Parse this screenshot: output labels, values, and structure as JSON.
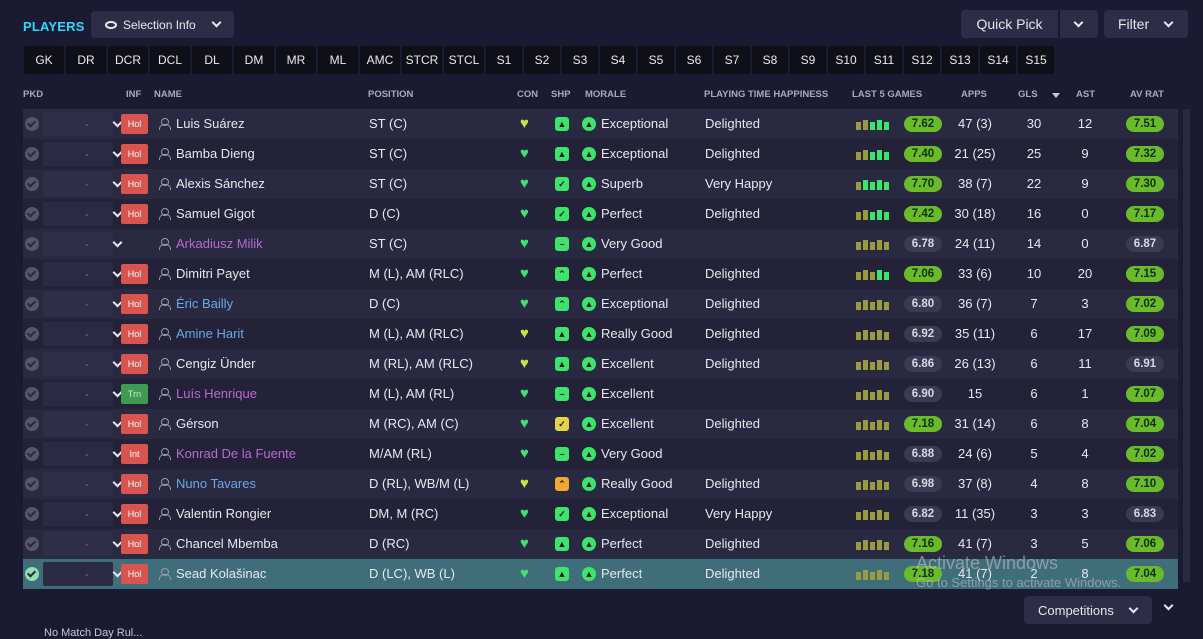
{
  "header": {
    "title": "PLAYERS",
    "selection_info": "Selection Info",
    "quick_pick": "Quick Pick",
    "filter": "Filter"
  },
  "tabs": [
    "GK",
    "DR",
    "DCR",
    "DCL",
    "DL",
    "DM",
    "MR",
    "ML",
    "AMC",
    "STCR",
    "STCL",
    "S1",
    "S2",
    "S3",
    "S4",
    "S5",
    "S6",
    "S7",
    "S8",
    "S9",
    "S10",
    "S11",
    "S12",
    "S13",
    "S14",
    "S15"
  ],
  "columns": {
    "pkd": "PKD",
    "inf": "INF",
    "name": "NAME",
    "position": "POSITION",
    "con": "CON",
    "shp": "SHP",
    "morale": "MORALE",
    "happiness": "PLAYING TIME HAPPINESS",
    "last5": "LAST 5 GAMES",
    "apps": "APPS",
    "gls": "GLS",
    "ast": "AST",
    "avrat": "AV RAT"
  },
  "players": [
    {
      "inf": "Hol",
      "name": "Luis Suárez",
      "name_color": "white",
      "position": "ST (C)",
      "con": "partial",
      "shp": "green",
      "shp_icon": "thumb",
      "morale": "Exceptional",
      "happiness": "Delighted",
      "last5": "7.62",
      "last5_good": true,
      "bars": [
        "y",
        "y",
        "g",
        "g",
        "g"
      ],
      "apps": "47 (3)",
      "gls": "30",
      "ast": "12",
      "avrat": "7.51",
      "avrat_good": true
    },
    {
      "inf": "Hol",
      "name": "Bamba Dieng",
      "name_color": "white",
      "position": "ST (C)",
      "con": "full",
      "shp": "green",
      "shp_icon": "thumb",
      "morale": "Exceptional",
      "happiness": "Delighted",
      "last5": "7.40",
      "last5_good": true,
      "bars": [
        "y",
        "y",
        "g",
        "g",
        "g"
      ],
      "apps": "21 (25)",
      "gls": "25",
      "ast": "9",
      "avrat": "7.32",
      "avrat_good": true
    },
    {
      "inf": "Hol",
      "name": "Alexis Sánchez",
      "name_color": "white",
      "position": "ST (C)",
      "con": "full",
      "shp": "green",
      "shp_icon": "check",
      "morale": "Superb",
      "happiness": "Very Happy",
      "last5": "7.70",
      "last5_good": true,
      "bars": [
        "y",
        "g",
        "g",
        "g",
        "g"
      ],
      "apps": "38 (7)",
      "gls": "22",
      "ast": "9",
      "avrat": "7.30",
      "avrat_good": true
    },
    {
      "inf": "Hol",
      "name": "Samuel Gigot",
      "name_color": "white",
      "position": "D (C)",
      "con": "full",
      "shp": "green",
      "shp_icon": "check",
      "morale": "Perfect",
      "happiness": "Delighted",
      "last5": "7.42",
      "last5_good": true,
      "bars": [
        "y",
        "y",
        "g",
        "g",
        "g"
      ],
      "apps": "30 (18)",
      "gls": "16",
      "ast": "0",
      "avrat": "7.17",
      "avrat_good": true
    },
    {
      "inf": "",
      "name": "Arkadiusz Milik",
      "name_color": "purple",
      "position": "ST (C)",
      "con": "full",
      "shp": "green",
      "shp_icon": "dash",
      "morale": "Very Good",
      "happiness": "",
      "last5": "6.78",
      "last5_good": false,
      "bars": [
        "y",
        "y",
        "y",
        "y",
        "y"
      ],
      "apps": "24 (11)",
      "gls": "14",
      "ast": "0",
      "avrat": "6.87",
      "avrat_good": false
    },
    {
      "inf": "Hol",
      "name": "Dimitri Payet",
      "name_color": "white",
      "position": "M (L), AM (RLC)",
      "con": "full",
      "shp": "green",
      "shp_icon": "up",
      "morale": "Perfect",
      "happiness": "Delighted",
      "last5": "7.06",
      "last5_good": true,
      "bars": [
        "y",
        "y",
        "y",
        "g",
        "g"
      ],
      "apps": "33 (6)",
      "gls": "10",
      "ast": "20",
      "avrat": "7.15",
      "avrat_good": true
    },
    {
      "inf": "Hol",
      "name": "Éric Bailly",
      "name_color": "blue",
      "position": "D (C)",
      "con": "full",
      "shp": "green",
      "shp_icon": "up",
      "morale": "Exceptional",
      "happiness": "Delighted",
      "last5": "6.80",
      "last5_good": false,
      "bars": [
        "y",
        "y",
        "y",
        "y",
        "y"
      ],
      "apps": "36 (7)",
      "gls": "7",
      "ast": "3",
      "avrat": "7.02",
      "avrat_good": true
    },
    {
      "inf": "Hol",
      "name": "Amine Harit",
      "name_color": "blue",
      "position": "M (L), AM (RLC)",
      "con": "partial",
      "shp": "green",
      "shp_icon": "thumb",
      "morale": "Really Good",
      "happiness": "Delighted",
      "last5": "6.92",
      "last5_good": false,
      "bars": [
        "y",
        "y",
        "y",
        "y",
        "y"
      ],
      "apps": "35 (11)",
      "gls": "6",
      "ast": "17",
      "avrat": "7.09",
      "avrat_good": true
    },
    {
      "inf": "Hol",
      "name": "Cengiz Ünder",
      "name_color": "white",
      "position": "M (RL), AM (RLC)",
      "con": "partial",
      "shp": "green",
      "shp_icon": "thumb",
      "morale": "Excellent",
      "happiness": "Delighted",
      "last5": "6.86",
      "last5_good": false,
      "bars": [
        "y",
        "y",
        "y",
        "y",
        "y"
      ],
      "apps": "26 (13)",
      "gls": "6",
      "ast": "11",
      "avrat": "6.91",
      "avrat_good": false
    },
    {
      "inf": "Trn",
      "name": "Luís Henrique",
      "name_color": "purple",
      "position": "M (L), AM (RL)",
      "con": "full",
      "shp": "green",
      "shp_icon": "dash",
      "morale": "Excellent",
      "happiness": "",
      "last5": "6.90",
      "last5_good": false,
      "bars": [
        "y",
        "y",
        "y",
        "y",
        "y"
      ],
      "apps": "15",
      "gls": "6",
      "ast": "1",
      "avrat": "7.07",
      "avrat_good": true
    },
    {
      "inf": "Hol",
      "name": "Gérson",
      "name_color": "white",
      "position": "M (RC), AM (C)",
      "con": "full",
      "shp": "yellow",
      "shp_icon": "check",
      "morale": "Excellent",
      "happiness": "Delighted",
      "last5": "7.18",
      "last5_good": true,
      "bars": [
        "y",
        "y",
        "y",
        "y",
        "y"
      ],
      "apps": "31 (14)",
      "gls": "6",
      "ast": "8",
      "avrat": "7.04",
      "avrat_good": true
    },
    {
      "inf": "Int",
      "name": "Konrad De la Fuente",
      "name_color": "purple",
      "position": "M/AM (RL)",
      "con": "full",
      "shp": "green",
      "shp_icon": "dash",
      "morale": "Very Good",
      "happiness": "",
      "last5": "6.88",
      "last5_good": false,
      "bars": [
        "y",
        "y",
        "y",
        "y",
        "y"
      ],
      "apps": "24 (6)",
      "gls": "5",
      "ast": "4",
      "avrat": "7.02",
      "avrat_good": true
    },
    {
      "inf": "Hol",
      "name": "Nuno Tavares",
      "name_color": "blue",
      "position": "D (RL), WB/M (L)",
      "con": "partial",
      "shp": "orange",
      "shp_icon": "up",
      "morale": "Really Good",
      "happiness": "Delighted",
      "last5": "6.98",
      "last5_good": false,
      "bars": [
        "y",
        "y",
        "y",
        "y",
        "y"
      ],
      "apps": "37 (8)",
      "gls": "4",
      "ast": "8",
      "avrat": "7.10",
      "avrat_good": true
    },
    {
      "inf": "Hol",
      "name": "Valentin Rongier",
      "name_color": "white",
      "position": "DM, M (RC)",
      "con": "full",
      "shp": "green",
      "shp_icon": "check",
      "morale": "Exceptional",
      "happiness": "Very Happy",
      "last5": "6.82",
      "last5_good": false,
      "bars": [
        "y",
        "y",
        "y",
        "y",
        "y"
      ],
      "apps": "11 (35)",
      "gls": "3",
      "ast": "3",
      "avrat": "6.83",
      "avrat_good": false
    },
    {
      "inf": "Hol",
      "name": "Chancel Mbemba",
      "name_color": "white",
      "position": "D (RC)",
      "con": "full",
      "shp": "green",
      "shp_icon": "thumb",
      "morale": "Perfect",
      "happiness": "Delighted",
      "last5": "7.16",
      "last5_good": true,
      "bars": [
        "y",
        "y",
        "y",
        "y",
        "y"
      ],
      "apps": "41 (7)",
      "gls": "3",
      "ast": "5",
      "avrat": "7.06",
      "avrat_good": true
    },
    {
      "inf": "Hol",
      "name": "Sead Kolašinac",
      "name_color": "white",
      "position": "D (LC), WB (L)",
      "con": "full",
      "shp": "green",
      "shp_icon": "thumb",
      "morale": "Perfect",
      "happiness": "Delighted",
      "last5": "7.18",
      "last5_good": true,
      "bars": [
        "y",
        "y",
        "y",
        "y",
        "y"
      ],
      "apps": "41 (7)",
      "gls": "2",
      "ast": "8",
      "avrat": "7.04",
      "avrat_good": true
    }
  ],
  "watermark": {
    "line1": "Activate Windows",
    "line2": "Go to Settings to activate Windows."
  },
  "footer": {
    "competitions": "Competitions",
    "bottom_text": "No Match Day Rul..."
  },
  "colors": {
    "accent": "#2fd9ff",
    "good_rating": "#6abb2a",
    "hol_badge": "#d9534f",
    "trn_badge": "#3f9a54"
  }
}
